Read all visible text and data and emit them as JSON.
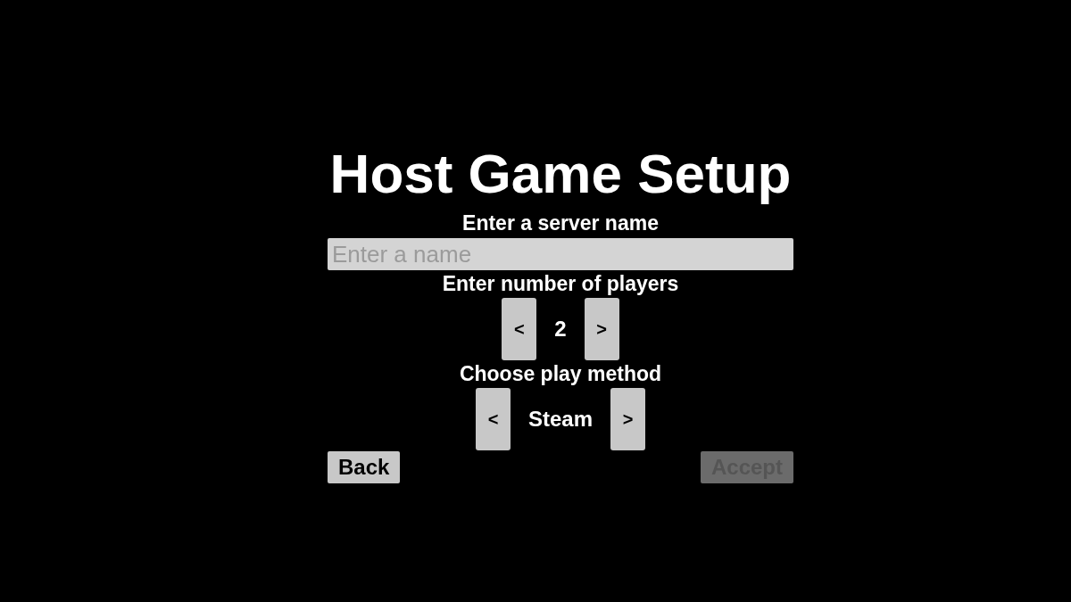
{
  "title": "Host Game Setup",
  "server_name": {
    "label": "Enter a server name",
    "placeholder": "Enter a name"
  },
  "players": {
    "label": "Enter number of players",
    "prev": "<",
    "value": "2",
    "next": ">"
  },
  "play_method": {
    "label": "Choose play method",
    "prev": "<",
    "value": "Steam",
    "next": ">"
  },
  "buttons": [
    {
      "label": "Back",
      "disabled": false
    },
    {
      "label": "Accept",
      "disabled": true
    }
  ]
}
